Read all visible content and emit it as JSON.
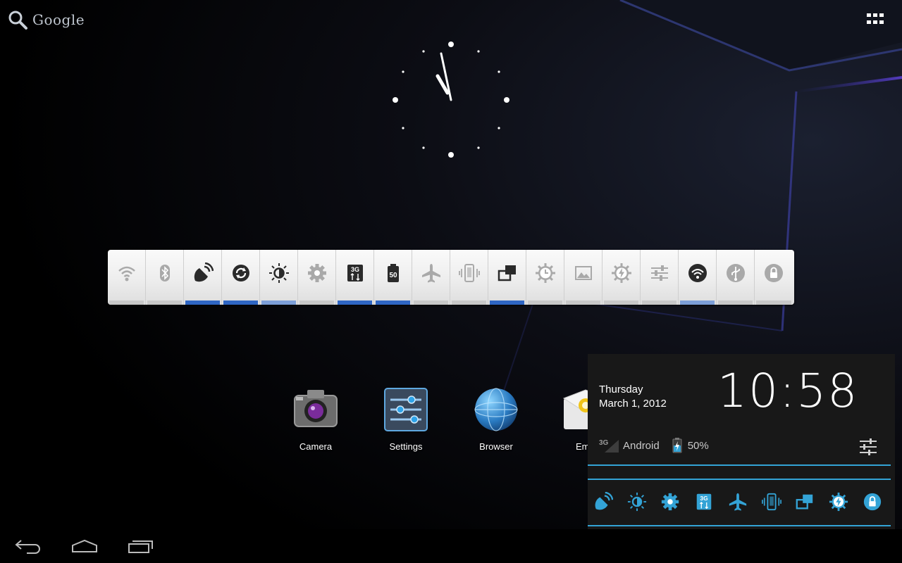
{
  "search": {
    "label": "Google",
    "icon": "search-icon"
  },
  "apps_button": {
    "icon": "all-apps-grid-icon"
  },
  "clock_widget": {
    "type": "analog",
    "icon": "analog-clock-icon"
  },
  "power_widget": {
    "toggles": [
      {
        "id": "wifi",
        "icon": "wifi-icon",
        "state": "off"
      },
      {
        "id": "bluetooth",
        "icon": "bluetooth-icon",
        "state": "off"
      },
      {
        "id": "gps",
        "icon": "gps-satellite-icon",
        "state": "on"
      },
      {
        "id": "sync",
        "icon": "sync-icon",
        "state": "on"
      },
      {
        "id": "brightness",
        "icon": "brightness-icon",
        "state": "auto"
      },
      {
        "id": "settings",
        "icon": "gear-icon",
        "state": "off"
      },
      {
        "id": "mobile-data",
        "icon": "3g-data-icon",
        "label": "3G",
        "state": "on"
      },
      {
        "id": "battery",
        "icon": "battery-icon",
        "label": "50",
        "state": "on"
      },
      {
        "id": "airplane",
        "icon": "airplane-icon",
        "state": "off"
      },
      {
        "id": "vibrate",
        "icon": "vibrate-icon",
        "state": "off"
      },
      {
        "id": "auto-rotate",
        "icon": "rotate-screen-icon",
        "state": "on"
      },
      {
        "id": "screen-timeout",
        "icon": "timeout-icon",
        "state": "off"
      },
      {
        "id": "wallpaper",
        "icon": "picture-icon",
        "state": "off"
      },
      {
        "id": "power-save",
        "icon": "power-save-icon",
        "state": "off"
      },
      {
        "id": "sound-settings",
        "icon": "sliders-icon",
        "state": "off"
      },
      {
        "id": "wifi-hotspot",
        "icon": "wifi-hotspot-icon",
        "state": "auto"
      },
      {
        "id": "usb",
        "icon": "usb-icon",
        "state": "off"
      },
      {
        "id": "lock",
        "icon": "lock-icon",
        "state": "off"
      }
    ]
  },
  "apps": [
    {
      "label": "Camera",
      "icon": "camera-icon"
    },
    {
      "label": "Settings",
      "icon": "settings-sliders-icon"
    },
    {
      "label": "Browser",
      "icon": "globe-icon"
    },
    {
      "label": "Em",
      "icon": "email-icon"
    }
  ],
  "notification_panel": {
    "day": "Thursday",
    "date": "March 1, 2012",
    "time": "10:58",
    "network_type": "3G",
    "carrier": "Android",
    "battery": "50%",
    "settings_icon": "sliders-icon",
    "quick_toggles": [
      "gps-satellite-icon",
      "brightness-icon",
      "gear-icon",
      "3g-data-icon",
      "airplane-icon",
      "vibrate-icon",
      "rotate-screen-icon",
      "power-save-icon",
      "lock-icon"
    ],
    "accent_color": "#33a3d6"
  },
  "navbar": {
    "back": "back-icon",
    "home": "home-icon",
    "recents": "recent-apps-icon"
  },
  "colors": {
    "toggle_on": "#2f66c4",
    "toggle_auto": "#7d9fd8",
    "toggle_off": "#c8c8c8"
  }
}
